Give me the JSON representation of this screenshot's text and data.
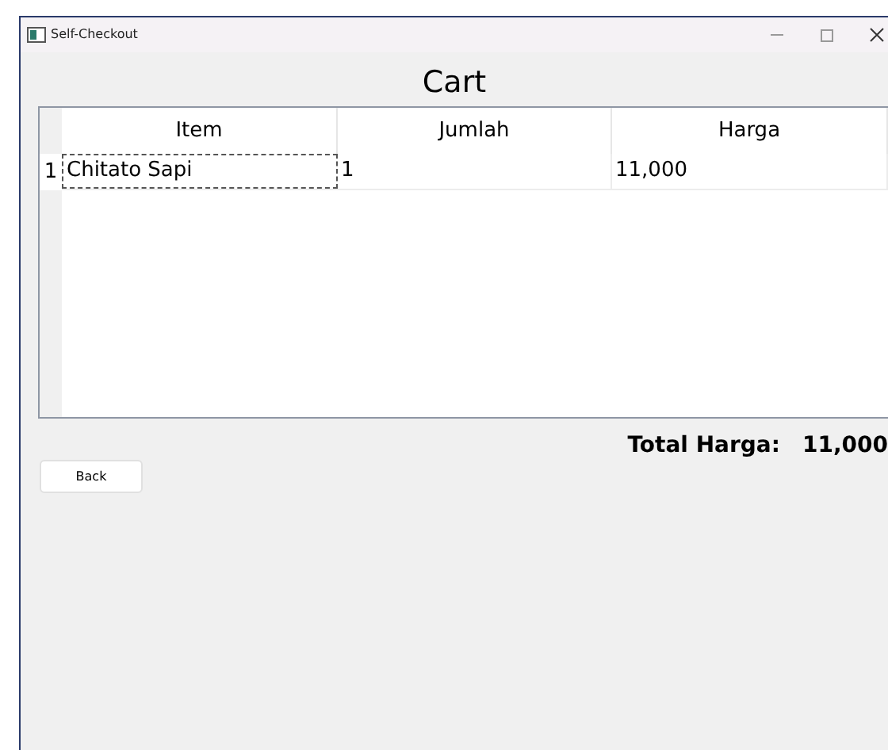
{
  "window": {
    "title": "Self-Checkout"
  },
  "heading": "Cart",
  "table": {
    "columns": [
      "Item",
      "Jumlah",
      "Harga"
    ],
    "rows": [
      {
        "number": "1",
        "cells": [
          {
            "text": "Chitato Sapi",
            "focused": true
          },
          {
            "text": "1",
            "focused": false
          },
          {
            "text": "11,000",
            "focused": false
          }
        ]
      }
    ]
  },
  "total": {
    "label": "Total Harga:",
    "value": "11,000"
  },
  "buttons": [
    "Back"
  ]
}
